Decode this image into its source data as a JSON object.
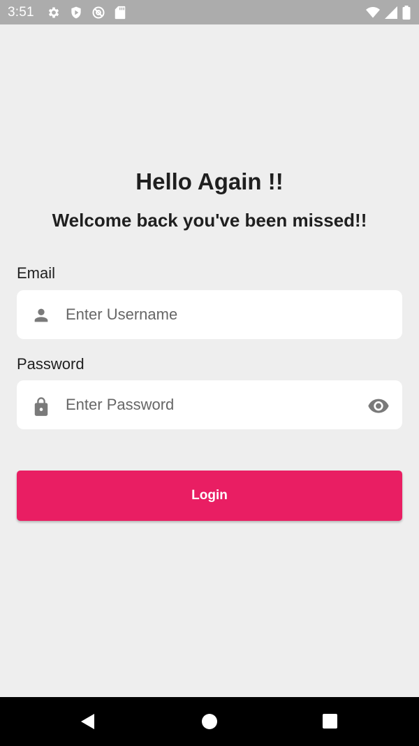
{
  "status_bar": {
    "time": "3:51",
    "left_icons": [
      "settings-icon",
      "shield-play-icon",
      "at-sign-icon",
      "sd-card-icon"
    ],
    "right_icons": [
      "wifi-icon",
      "cell-signal-icon",
      "battery-icon"
    ]
  },
  "login": {
    "title": "Hello Again !!",
    "subtitle": "Welcome back you've been missed!!",
    "email": {
      "label": "Email",
      "placeholder": "Enter Username",
      "value": "",
      "icon": "person-icon"
    },
    "password": {
      "label": "Password",
      "placeholder": "Enter Password",
      "value": "",
      "icon": "lock-icon",
      "toggle_icon": "eye-icon"
    },
    "login_label": "Login"
  },
  "colors": {
    "background": "#eeeeee",
    "status_bar": "#acacac",
    "accent": "#e91e63",
    "icon_gray": "#7a7a7a",
    "nav_bar": "#000000"
  },
  "nav_bar": {
    "buttons": [
      "back-icon",
      "home-icon",
      "recents-icon"
    ]
  }
}
